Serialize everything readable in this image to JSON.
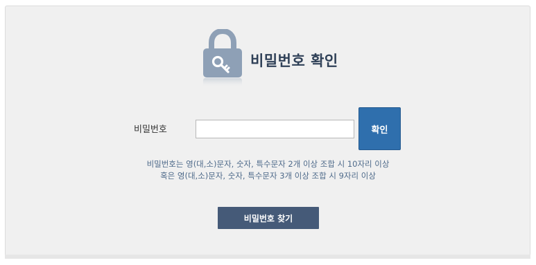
{
  "header": {
    "title": "비밀번호 확인",
    "icon": "lock-key-icon"
  },
  "form": {
    "password_label": "비밀번호",
    "password_value": "",
    "confirm_label": "확인"
  },
  "hint": {
    "line1": "비밀번호는 영(대,소)문자, 숫자, 특수문자 2개 이상 조합 시 10자리 이상",
    "line2": "혹은 영(대,소)문자, 숫자, 특수문자 3개 이상 조합 시 9자리 이상"
  },
  "actions": {
    "find_password_label": "비밀번호 찾기"
  },
  "colors": {
    "accent": "#2f6fad",
    "title": "#2f4057",
    "secondary_button": "#455a78",
    "hint_text": "#4e6a8a",
    "panel_bg": "#f0f0f0"
  }
}
